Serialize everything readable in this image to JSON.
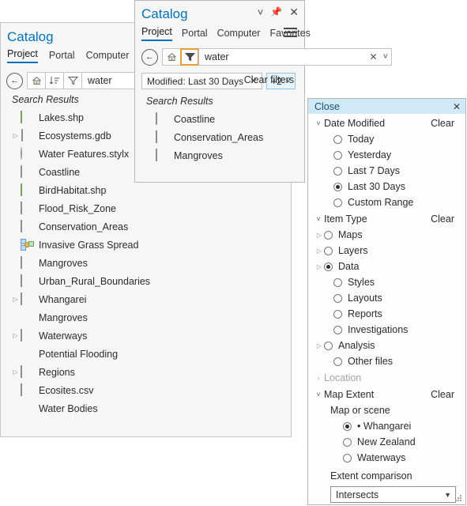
{
  "left_panel": {
    "title": "Catalog",
    "tabs": [
      {
        "label": "Project",
        "active": true
      },
      {
        "label": "Portal",
        "active": false
      },
      {
        "label": "Computer",
        "active": false
      }
    ],
    "toolbar": {
      "back_icon": "back-arrow-icon",
      "home_icon": "home-icon",
      "sort_icon": "sort-icon",
      "filter_icon": "filter-funnel-icon",
      "search_value": "water"
    },
    "results_label": "Search Results",
    "items": [
      {
        "label": "Lakes.shp",
        "icon": "shapefile-icon",
        "expand": false
      },
      {
        "label": "Ecosystems.gdb",
        "icon": "geodatabase-icon",
        "expand": true
      },
      {
        "label": "Water Features.stylx",
        "icon": "style-icon",
        "expand": false
      },
      {
        "label": "Coastline",
        "icon": "line-feature-icon",
        "expand": false
      },
      {
        "label": "BirdHabitat.shp",
        "icon": "shapefile-icon",
        "expand": false
      },
      {
        "label": "Flood_Risk_Zone",
        "icon": "table-icon",
        "expand": false
      },
      {
        "label": "Conservation_Areas",
        "icon": "table-icon",
        "expand": false
      },
      {
        "label": "Invasive Grass Spread",
        "icon": "geoprocessing-model-icon",
        "expand": false
      },
      {
        "label": "Mangroves",
        "icon": "table-icon",
        "expand": false
      },
      {
        "label": "Urban_Rural_Boundaries",
        "icon": "table-icon",
        "expand": false
      },
      {
        "label": "Whangarei",
        "icon": "map-icon",
        "expand": true
      },
      {
        "label": "Mangroves",
        "icon": "folder-icon",
        "expand": false
      },
      {
        "label": "Waterways",
        "icon": "scene-icon",
        "expand": true
      },
      {
        "label": "Potential Flooding",
        "icon": "folder-icon",
        "expand": false
      },
      {
        "label": "Regions",
        "icon": "map-icon",
        "expand": true
      },
      {
        "label": "Ecosites.csv",
        "icon": "csv-icon",
        "expand": false
      },
      {
        "label": "Water Bodies",
        "icon": "folder-icon",
        "expand": false
      }
    ]
  },
  "catalog_window": {
    "title": "Catalog",
    "window_buttons": {
      "minimize_icon": "chevron-down-icon",
      "pin_icon": "pin-icon",
      "close_icon": "close-icon"
    },
    "tabs": [
      {
        "label": "Project",
        "active": true
      },
      {
        "label": "Portal",
        "active": false
      },
      {
        "label": "Computer",
        "active": false
      },
      {
        "label": "Favorites",
        "active": false
      }
    ],
    "menu_icon": "hamburger-menu-icon",
    "toolbar": {
      "back_icon": "back-arrow-icon",
      "home_icon": "home-icon",
      "filter_icon": "filter-funnel-icon",
      "search_value": "water",
      "clear_icon": "clear-x-icon",
      "dropdown_icon": "chevron-down-icon"
    },
    "filter_chip": {
      "label": "Modified: Last 30 Days",
      "remove_icon": "remove-x-icon"
    },
    "more_filters": {
      "label": "+2",
      "chevron_icon": "chevron-down-icon"
    },
    "clear_filters_label": "Clear filters",
    "results_label": "Search Results",
    "results": [
      {
        "label": "Coastline",
        "icon": "line-feature-icon"
      },
      {
        "label": "Conservation_Areas",
        "icon": "table-icon"
      },
      {
        "label": "Mangroves",
        "icon": "table-icon"
      }
    ]
  },
  "filter_flyout": {
    "header": {
      "label": "Close",
      "close_icon": "close-icon"
    },
    "groups": [
      {
        "name": "Date Modified",
        "clear_label": "Clear",
        "expanded": true,
        "disabled": false,
        "options": [
          {
            "label": "Today",
            "selected": false,
            "has_expander": false
          },
          {
            "label": "Yesterday",
            "selected": false,
            "has_expander": false
          },
          {
            "label": "Last 7 Days",
            "selected": false,
            "has_expander": false
          },
          {
            "label": "Last 30 Days",
            "selected": true,
            "has_expander": false
          },
          {
            "label": "Custom Range",
            "selected": false,
            "has_expander": false
          }
        ]
      },
      {
        "name": "Item Type",
        "clear_label": "Clear",
        "expanded": true,
        "disabled": false,
        "options": [
          {
            "label": "Maps",
            "selected": false,
            "has_expander": true
          },
          {
            "label": "Layers",
            "selected": false,
            "has_expander": true
          },
          {
            "label": "Data",
            "selected": true,
            "has_expander": true
          },
          {
            "label": "Styles",
            "selected": false,
            "has_expander": false
          },
          {
            "label": "Layouts",
            "selected": false,
            "has_expander": false
          },
          {
            "label": "Reports",
            "selected": false,
            "has_expander": false
          },
          {
            "label": "Investigations",
            "selected": false,
            "has_expander": false
          },
          {
            "label": "Analysis",
            "selected": false,
            "has_expander": true
          },
          {
            "label": "Other files",
            "selected": false,
            "has_expander": false
          }
        ]
      },
      {
        "name": "Location",
        "clear_label": "",
        "expanded": false,
        "disabled": true,
        "options": []
      }
    ],
    "map_extent": {
      "name": "Map Extent",
      "clear_label": "Clear",
      "sub_label": "Map or scene",
      "options": [
        {
          "label": "• Whangarei",
          "selected": true
        },
        {
          "label": "New Zealand",
          "selected": false
        },
        {
          "label": "Waterways",
          "selected": false
        }
      ],
      "comparison_label": "Extent comparison",
      "comparison_value": "Intersects",
      "comparison_chevron": "chevron-down-icon"
    },
    "resize_grip_icon": "resize-grip-icon"
  },
  "colors": {
    "accent": "#0072bc",
    "highlight_orange": "#eb9c36",
    "header_blue": "#cfe9f7",
    "chip_blue": "#e8f4fb"
  }
}
